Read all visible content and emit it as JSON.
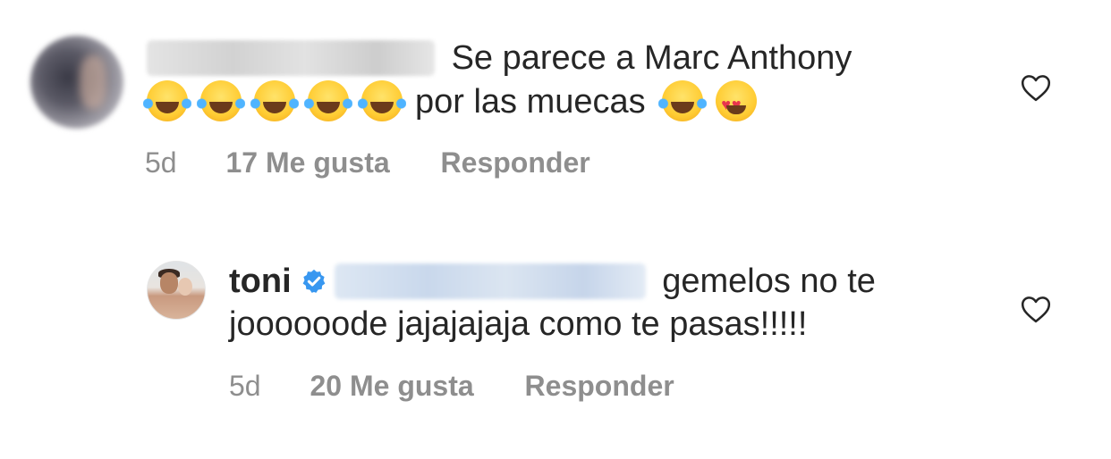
{
  "comments": [
    {
      "text_line1": "Se parece a Marc Anthony",
      "text_line2": "por las muecas",
      "time": "5d",
      "likes": "17 Me gusta",
      "reply_label": "Responder",
      "emojis_before": [
        "face-with-tears-of-joy",
        "face-with-tears-of-joy",
        "face-with-tears-of-joy",
        "face-with-tears-of-joy",
        "face-with-tears-of-joy"
      ],
      "emojis_after": [
        "face-with-tears-of-joy",
        "smiling-face-with-heart-eyes"
      ]
    },
    {
      "username": "toni",
      "verified": true,
      "text_line1": "gemelos no te",
      "text_line2": "joooooode jajajajaja como te pasas!!!!!",
      "time": "5d",
      "likes": "20 Me gusta",
      "reply_label": "Responder"
    }
  ],
  "colors": {
    "text": "#262626",
    "meta": "#8e8e8e",
    "verified": "#3897f0"
  }
}
